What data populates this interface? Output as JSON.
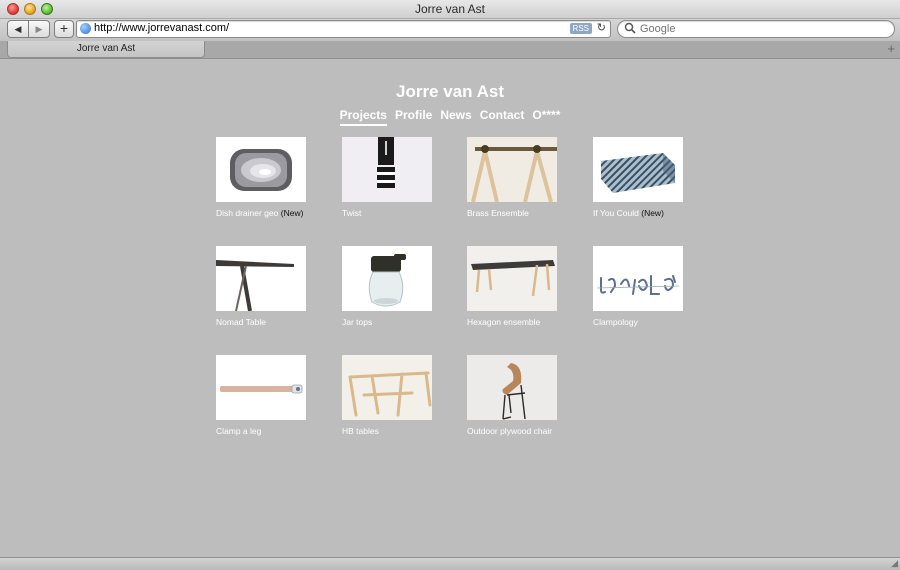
{
  "window": {
    "title": "Jorre van Ast"
  },
  "toolbar": {
    "back_icon": "◀",
    "forward_icon": "▶",
    "add_icon": "+",
    "url": "http://www.jorrevanast.com/",
    "rss_label": "RSS",
    "reload_icon": "↻",
    "search_placeholder": "Google",
    "search_icon": "🔍︎"
  },
  "tabs": [
    {
      "label": "Jorre van Ast"
    }
  ],
  "new_tab_icon": "+",
  "site": {
    "title": "Jorre van Ast",
    "nav": [
      {
        "label": "Projects",
        "active": true
      },
      {
        "label": "Profile"
      },
      {
        "label": "News"
      },
      {
        "label": "Contact"
      },
      {
        "label": "O****"
      }
    ]
  },
  "projects": [
    {
      "label": "Dish drainer geo",
      "badge": "(New)"
    },
    {
      "label": "Twist"
    },
    {
      "label": "Brass Ensemble"
    },
    {
      "label": "If You Could",
      "badge": "(New)"
    },
    {
      "label": "Nomad Table"
    },
    {
      "label": "Jar tops"
    },
    {
      "label": "Hexagon ensemble"
    },
    {
      "label": "Clampology"
    },
    {
      "label": "Clamp a leg"
    },
    {
      "label": "HB tables"
    },
    {
      "label": "Outdoor plywood chair"
    }
  ],
  "colors": {
    "page_bg": "#bdbdbd",
    "text": "#ffffff",
    "badge_text": "#111111"
  }
}
